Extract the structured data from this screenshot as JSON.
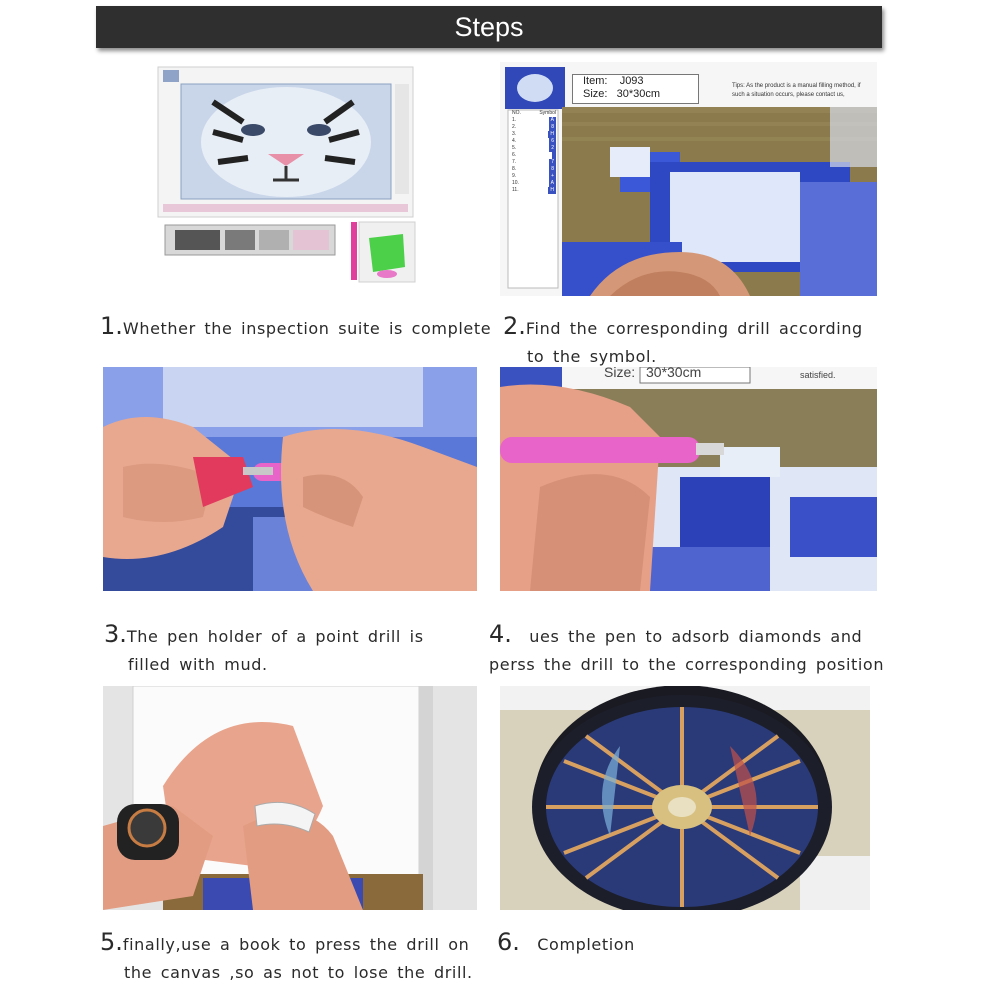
{
  "header": {
    "title": "Steps"
  },
  "kit": {
    "item_label": "Item:",
    "item_value": "J093",
    "size_label": "Size:",
    "size_value": "30*30cm",
    "tips_text": "Tips: As the product is a manual filling method, if such a situation occurs, please contact us,",
    "satisfied_text": "satisfied.",
    "table_header_no": "NO.",
    "table_header_symbol": "Symbol",
    "table_numbers": [
      "1.",
      "2.",
      "3.",
      "4.",
      "5.",
      "6.",
      "7.",
      "8.",
      "9.",
      "10.",
      "11."
    ],
    "table_symbols": [
      "A",
      "8",
      "H",
      "6",
      "2",
      "",
      "7",
      "8",
      "+",
      "A",
      "H"
    ]
  },
  "steps": [
    {
      "number": "1.",
      "text_line1": "Whether the inspection suite is complete",
      "text_line2": ""
    },
    {
      "number": "2.",
      "text_line1": "Find the corresponding drill according",
      "text_line2": "to the symbol."
    },
    {
      "number": "3.",
      "text_line1": "The pen holder of a point drill is",
      "text_line2": "filled with mud."
    },
    {
      "number": "4.",
      "text_line1": "ues the pen to adsorb diamonds and",
      "text_line2": "perss the drill to the corresponding position"
    },
    {
      "number": "5.",
      "text_line1": "finally,use a book to press the drill on",
      "text_line2": "the canvas ,so as not to lose the drill."
    },
    {
      "number": "6.",
      "text_line1": "Completion",
      "text_line2": ""
    }
  ],
  "colors": {
    "header_bg": "#2f2f2f",
    "pen_pink": "#e864c8",
    "canvas_blue": "#3b4fc0",
    "skin": "#e8a890"
  }
}
